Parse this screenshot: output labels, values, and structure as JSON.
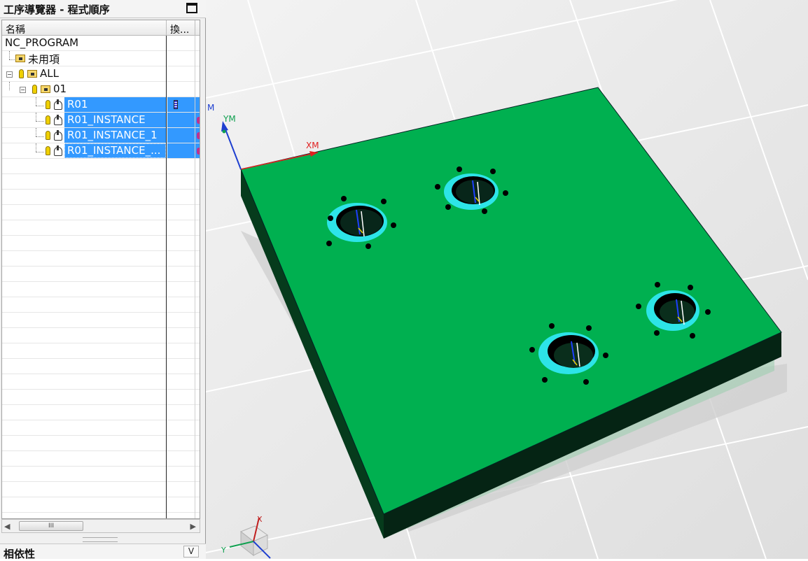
{
  "navigator": {
    "title": "工序導覽器 - 程式順序",
    "columns": {
      "name": "名稱",
      "col2": "換..."
    },
    "tree": [
      {
        "label": "NC_PROGRAM"
      },
      {
        "label": "未用項"
      },
      {
        "label": "ALL"
      },
      {
        "label": "01"
      },
      {
        "label": "R01",
        "selected": true
      },
      {
        "label": "R01_INSTANCE",
        "selected": true
      },
      {
        "label": "R01_INSTANCE_1",
        "selected": true
      },
      {
        "label": "R01_INSTANCE_...",
        "selected": true
      }
    ],
    "scrollbar": {
      "thumb": "III",
      "left": "◀",
      "right": "▶"
    }
  },
  "dependency_panel": {
    "title": "相依性",
    "toggle": "V"
  },
  "viewport": {
    "axis_labels": {
      "x": "XM",
      "y": "YM",
      "z": "M"
    },
    "triad_labels": {
      "x": "X",
      "y": "Y"
    },
    "part_color": "#00b050",
    "hole_ring_color": "#2de4e8"
  }
}
